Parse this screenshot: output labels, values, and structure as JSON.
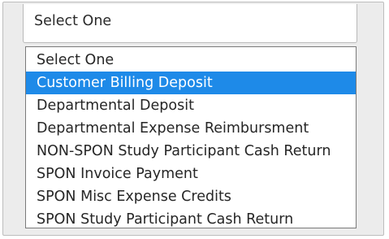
{
  "select": {
    "current_value": "Select One",
    "options": [
      {
        "label": "Select One",
        "highlighted": false
      },
      {
        "label": "Customer Billing Deposit",
        "highlighted": true
      },
      {
        "label": "Departmental Deposit",
        "highlighted": false
      },
      {
        "label": "Departmental Expense Reimbursment",
        "highlighted": false
      },
      {
        "label": "NON-SPON Study Participant Cash Return",
        "highlighted": false
      },
      {
        "label": "SPON Invoice Payment",
        "highlighted": false
      },
      {
        "label": "SPON Misc Expense Credits",
        "highlighted": false
      },
      {
        "label": "SPON Study Participant Cash Return",
        "highlighted": false
      }
    ]
  },
  "colors": {
    "highlight": "#1e8ae8",
    "highlight_text": "#ffffff",
    "frame_background": "#ececec"
  }
}
